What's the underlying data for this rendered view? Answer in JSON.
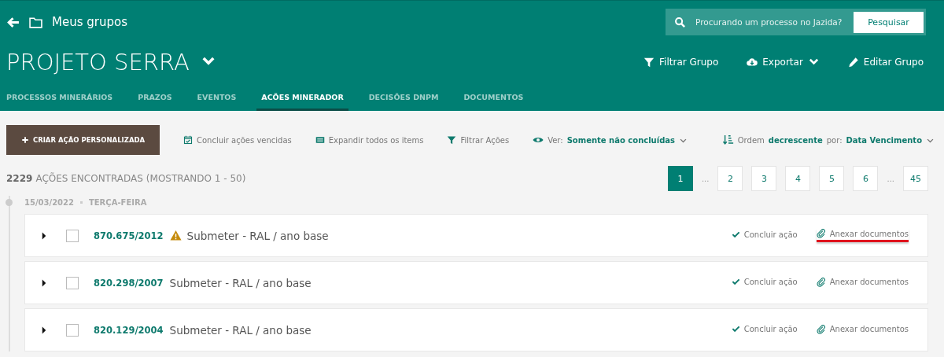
{
  "header": {
    "back_label": "Meus grupos",
    "title": "PROJETO SERRA",
    "search": {
      "placeholder": "Procurando um processo no Jazida?",
      "button": "Pesquisar"
    },
    "actions": [
      {
        "kind": "filter",
        "label": "Filtrar Grupo"
      },
      {
        "kind": "export",
        "label": "Exportar"
      },
      {
        "kind": "edit",
        "label": "Editar Grupo"
      }
    ],
    "tabs": [
      {
        "label": "PROCESSOS MINERÁRIOS",
        "selected": false
      },
      {
        "label": "PRAZOS",
        "selected": false
      },
      {
        "label": "EVENTOS",
        "selected": false
      },
      {
        "label": "ACÕES MINERADOR",
        "selected": true
      },
      {
        "label": "DECISÕES DNPM",
        "selected": false
      },
      {
        "label": "DOCUMENTOS",
        "selected": false
      }
    ]
  },
  "toolbar": {
    "create_button": "CRIAR AÇÃO PERSONALIZADA",
    "links": [
      {
        "kind": "calendar",
        "label": "Concluir ações vencidas"
      },
      {
        "kind": "list",
        "label": "Expandir todos os items"
      },
      {
        "kind": "filter",
        "label": "Filtrar Ações"
      }
    ],
    "view": {
      "label": "Ver:",
      "value": "Somente não concluídas"
    },
    "order": {
      "label": "Ordem",
      "direction": "decrescente",
      "by_label": "por:",
      "value": "Data Vencimento"
    }
  },
  "summary": {
    "count": "2229",
    "text": "AÇÕES ENCONTRADAS",
    "range": "(MOSTRANDO 1 - 50)"
  },
  "pagination": [
    {
      "kind": "page",
      "label": "1",
      "selected": true
    },
    {
      "kind": "ellipsis",
      "label": "..."
    },
    {
      "kind": "page",
      "label": "2",
      "selected": false
    },
    {
      "kind": "page",
      "label": "3",
      "selected": false
    },
    {
      "kind": "page",
      "label": "4",
      "selected": false
    },
    {
      "kind": "page",
      "label": "5",
      "selected": false
    },
    {
      "kind": "page",
      "label": "6",
      "selected": false
    },
    {
      "kind": "ellipsis",
      "label": "..."
    },
    {
      "kind": "page",
      "label": "45",
      "selected": false
    }
  ],
  "date_group": {
    "date": "15/03/2022",
    "weekday": "TERÇA-FEIRA"
  },
  "rows": [
    {
      "process": "870.675/2012",
      "warning": true,
      "title": "Submeter - RAL / ano base",
      "checked": false,
      "conclude": "Concluir ação",
      "attach": "Anexar documentos",
      "highlighted": true
    },
    {
      "process": "820.298/2007",
      "warning": false,
      "title": "Submeter - RAL / ano base",
      "checked": false,
      "conclude": "Concluir ação",
      "attach": "Anexar documentos",
      "highlighted": false
    },
    {
      "process": "820.129/2004",
      "warning": false,
      "title": "Submeter - RAL / ano base",
      "checked": false,
      "conclude": "Concluir ação",
      "attach": "Anexar documentos",
      "highlighted": false
    }
  ]
}
